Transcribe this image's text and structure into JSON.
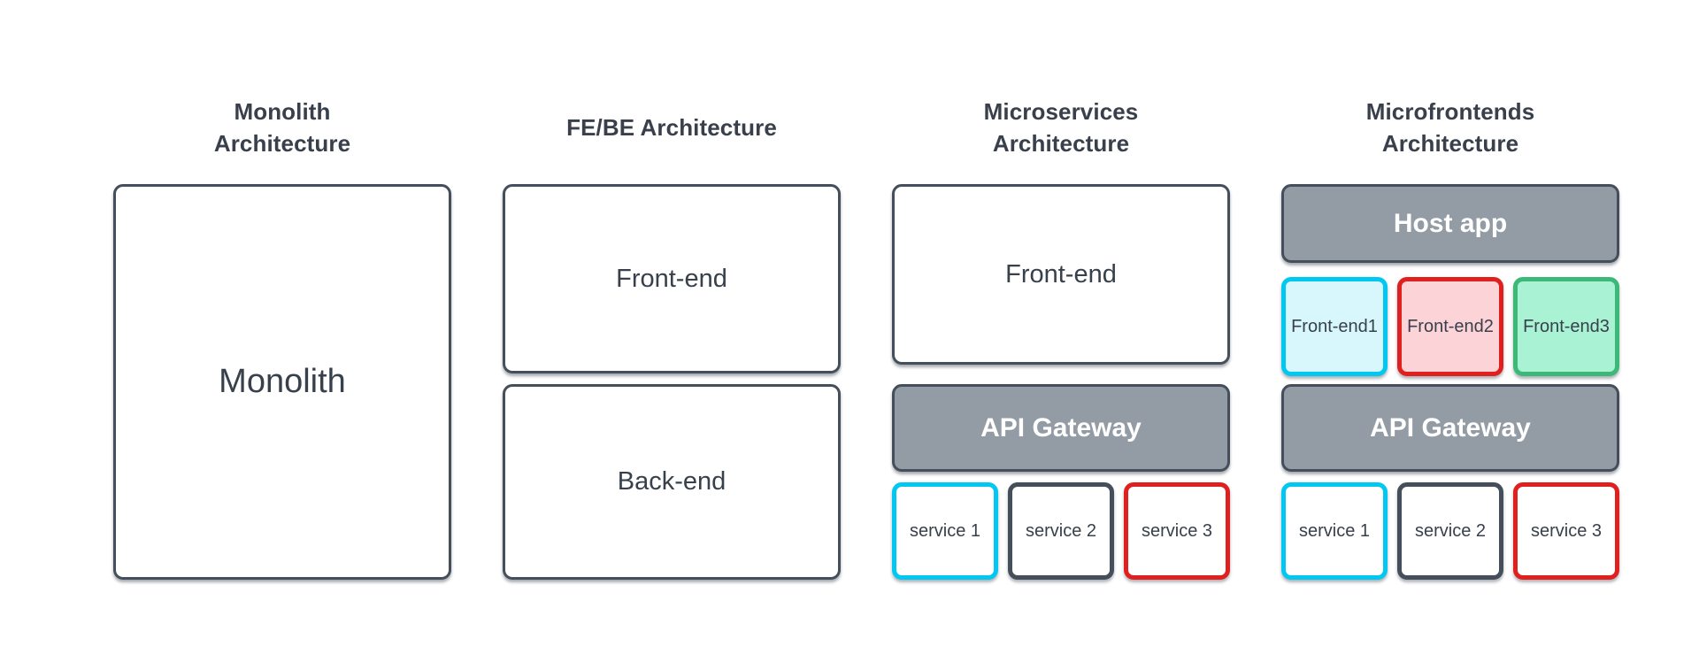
{
  "diagram": {
    "title_color": "#39404b",
    "accent_colors": {
      "cyan": "#00c8f0",
      "red": "#e01f1f",
      "green": "#3cb878",
      "slate": "#454f5b",
      "gateway_fill": "#939ba5"
    },
    "columns": [
      {
        "id": "monolith",
        "title_line1": "Monolith",
        "title_line2": "Architecture",
        "boxes": {
          "monolith": "Monolith"
        }
      },
      {
        "id": "fe-be",
        "title_line1": "FE/BE Architecture",
        "title_line2": "",
        "boxes": {
          "frontend": "Front-end",
          "backend": "Back-end"
        }
      },
      {
        "id": "microservices",
        "title_line1": "Microservices",
        "title_line2": "Architecture",
        "boxes": {
          "frontend": "Front-end",
          "gateway": "API Gateway"
        },
        "services": [
          {
            "label": "service 1",
            "border": "#00c8f0",
            "fill": "#ffffff"
          },
          {
            "label": "service 2",
            "border": "#454f5b",
            "fill": "#ffffff"
          },
          {
            "label": "service 3",
            "border": "#e01f1f",
            "fill": "#ffffff"
          }
        ]
      },
      {
        "id": "microfrontends",
        "title_line1": "Microfrontends",
        "title_line2": "Architecture",
        "boxes": {
          "host_app": "Host app",
          "gateway": "API Gateway"
        },
        "frontends": [
          {
            "label": "Front-end1",
            "border": "#00c8f0",
            "fill": "#d8f7fd"
          },
          {
            "label": "Front-end2",
            "border": "#e01f1f",
            "fill": "#fcd4d8"
          },
          {
            "label": "Front-end3",
            "border": "#3cb878",
            "fill": "#a9f2d3"
          }
        ],
        "services": [
          {
            "label": "service 1",
            "border": "#00c8f0",
            "fill": "#ffffff"
          },
          {
            "label": "service 2",
            "border": "#454f5b",
            "fill": "#ffffff"
          },
          {
            "label": "service 3",
            "border": "#e01f1f",
            "fill": "#ffffff"
          }
        ]
      }
    ]
  }
}
